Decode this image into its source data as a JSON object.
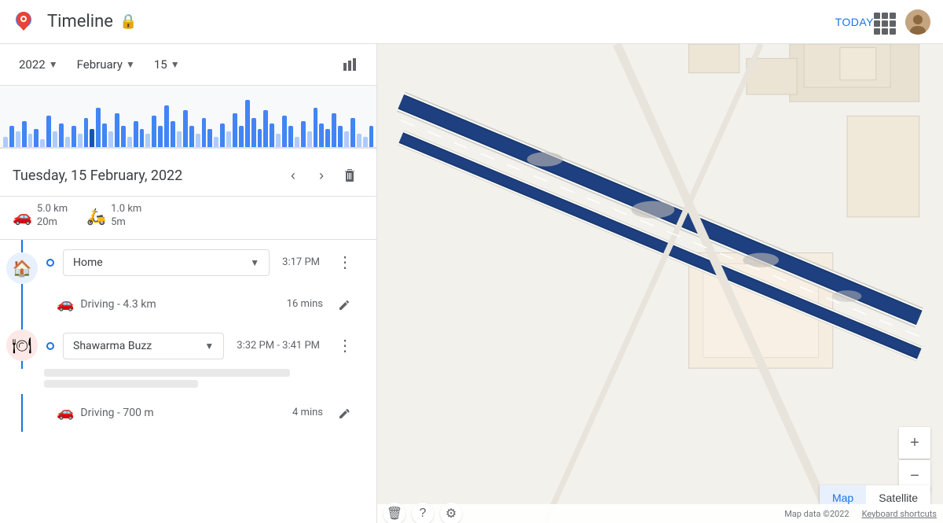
{
  "header": {
    "title": "Timeline",
    "today_label": "TODAY",
    "lock_icon": "🔒"
  },
  "date_selector": {
    "year": "2022",
    "month": "February",
    "day": "15",
    "chart_icon": "📊"
  },
  "bar_chart": {
    "bars": [
      4,
      8,
      6,
      10,
      5,
      7,
      3,
      12,
      6,
      9,
      4,
      8,
      5,
      11,
      7,
      15,
      9,
      6,
      13,
      8,
      4,
      10,
      7,
      5,
      12,
      8,
      16,
      10,
      6,
      14,
      8,
      5,
      11,
      7,
      4,
      9,
      6,
      13,
      8,
      18,
      11,
      7,
      14,
      9,
      5,
      12,
      8,
      4,
      10,
      6,
      15,
      9,
      7,
      13,
      8,
      6,
      11,
      5,
      4,
      8
    ]
  },
  "timeline": {
    "date_title": "Tuesday, 15 February, 2022",
    "stats": [
      {
        "icon": "🚗",
        "distance": "5.0 km",
        "duration": "20m"
      },
      {
        "icon": "🛵",
        "distance": "1.0 km",
        "duration": "5m"
      }
    ],
    "items": [
      {
        "type": "location",
        "icon_type": "home",
        "icon": "🏠",
        "name": "Home",
        "time": "3:17 PM"
      },
      {
        "type": "travel",
        "icon": "🚗",
        "text": "Driving - 4.3 km",
        "duration": "16 mins"
      },
      {
        "type": "location",
        "icon_type": "food",
        "icon": "🍽",
        "name": "Shawarma Buzz",
        "time": "3:32 PM - 3:41 PM",
        "address": "████████████████████████████████████"
      },
      {
        "type": "travel",
        "icon": "🚗",
        "text": "Driving - 700 m",
        "duration": "4 mins"
      }
    ]
  },
  "map": {
    "data_label": "Map data ©2022",
    "keyboard_label": "Keyboard shortcuts",
    "bottom_icons": [
      "🗑",
      "❓",
      "⚙"
    ],
    "map_type_options": [
      "Map",
      "Satellite"
    ],
    "active_map_type": "Map"
  }
}
